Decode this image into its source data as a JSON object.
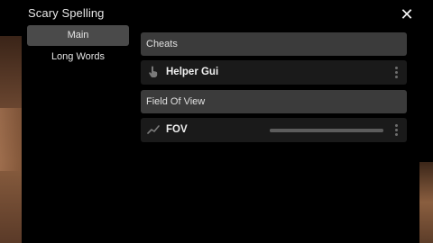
{
  "window": {
    "title": "Scary Spelling",
    "close_glyph": "✕"
  },
  "sidebar": {
    "items": [
      {
        "label": "Main",
        "active": true
      },
      {
        "label": "Long Words",
        "active": false
      }
    ]
  },
  "main": {
    "sections": [
      {
        "header": "Cheats",
        "rows": [
          {
            "label": "Helper Gui",
            "icon": "pointer-hand-icon",
            "type": "button"
          }
        ]
      },
      {
        "header": "Field Of View",
        "rows": [
          {
            "label": "FOV",
            "icon": "trend-line-icon",
            "type": "slider",
            "value_fraction": 1.0
          }
        ]
      }
    ]
  },
  "colors": {
    "panel": "#000000",
    "section_header": "#3b3b3b",
    "row": "#1a1a1a",
    "active_nav": "#4a4a4a"
  }
}
